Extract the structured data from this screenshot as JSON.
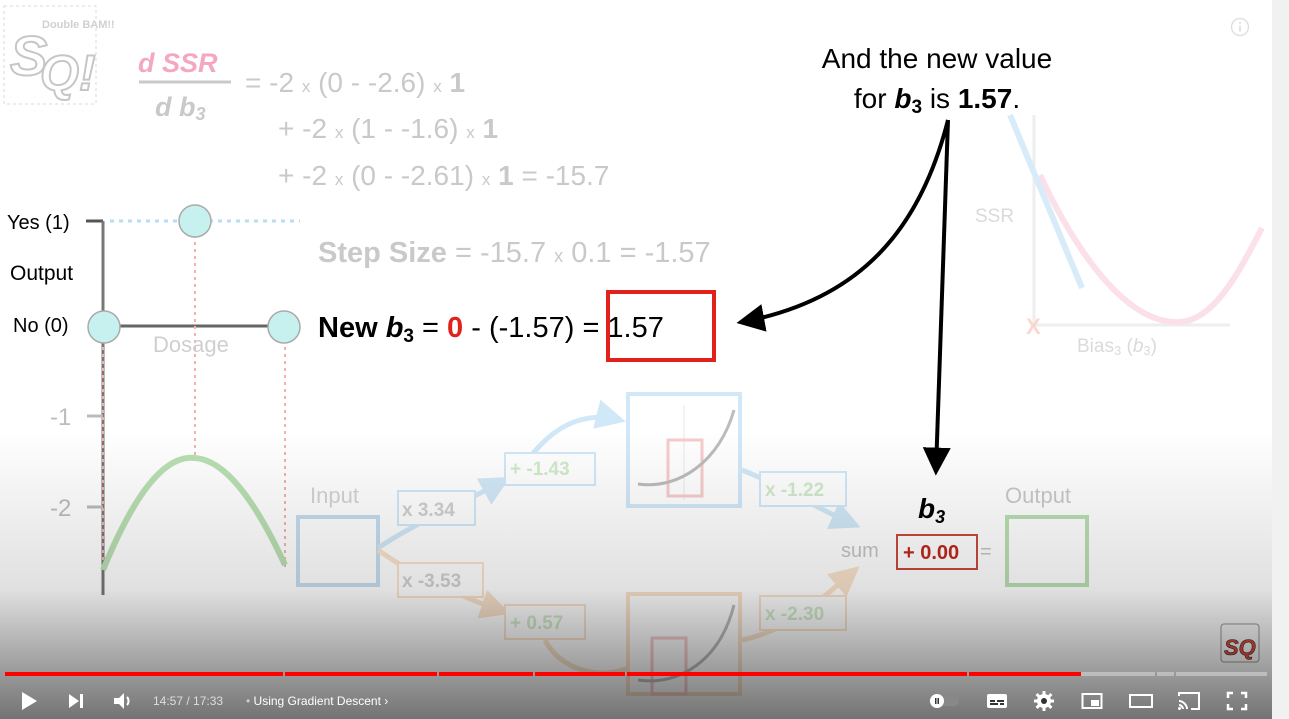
{
  "video": {
    "logo_text": "Double BAM!!",
    "derivative": {
      "numerator": "d SSR",
      "denominator_d": "d",
      "denominator_b": "b",
      "denominator_sub": "3",
      "line1_prefix": "= -2 ",
      "line1_mid": "(0 - -2.6)",
      "line1_one": "1",
      "line2_prefix": "+ -2 ",
      "line2_mid": "(1 - -1.6)",
      "line2_one": "1",
      "line3_prefix": "+ -2 ",
      "line3_mid": "(0 - -2.61)",
      "line3_one": "1",
      "line3_result": " = -15.7",
      "times": "x"
    },
    "step_size": {
      "label": "Step Size",
      "expr": " = -15.7 ",
      "expr2": " 0.1 = -1.57",
      "times": "x"
    },
    "new_b3": {
      "label_new": "New ",
      "label_b": "b",
      "sub": "3",
      "eq": " = ",
      "zero": "0",
      "minus": " - (-1.57) ",
      "boxed": "= 1.57"
    },
    "callout": {
      "line1": "And the new value",
      "line2_pre": "for ",
      "line2_b": "b",
      "line2_sub": "3",
      "line2_mid": " is ",
      "line2_val": "1.57",
      "line2_end": "."
    },
    "left_plot": {
      "yes_label": "Yes (1)",
      "output_label": "Output",
      "no_label": "No (0)",
      "dosage_label": "Dosage",
      "tick_neg1": "-1",
      "tick_neg2": "-2"
    },
    "ssr_plot": {
      "ylabel": "SSR",
      "xlabel_pre": "Bias",
      "xlabel_sub": "3",
      "xlabel_paren_b": "b",
      "xlabel_paren_sub": "3",
      "marker": "X"
    },
    "network": {
      "input_label": "Input",
      "w_top": "x 3.34",
      "w_bottom": "x -3.53",
      "b_top": "+ -1.43",
      "b_bottom": "+ 0.57",
      "w_out_top": "x -1.22",
      "w_out_bottom": "x -2.30",
      "b3_label": "b",
      "b3_sub": "3",
      "sum_label": "sum",
      "bias_value": "+ 0.00",
      "equals": "=",
      "output_label": "Output"
    },
    "colors": {
      "red": "#e3211c",
      "pink": "#f4a7c0",
      "blue": "#9dcbee",
      "orange": "#f3c79a",
      "green": "#a8d8a0",
      "teal": "#c6f1ee"
    }
  },
  "player": {
    "progress_played_fraction": 0.853,
    "time_current": "14:57",
    "time_separator": " / ",
    "time_total": "17:33",
    "chapter_bullet": "•",
    "chapter_title": "Using Gradient Descent",
    "icons": {
      "play": "play-icon",
      "next": "next-icon",
      "volume": "volume-icon",
      "autoplay": "autoplay-toggle-icon",
      "subtitles": "subtitles-icon",
      "settings": "gear-icon",
      "miniplayer": "miniplayer-icon",
      "theater": "theater-mode-icon",
      "cast": "cast-icon",
      "fullscreen": "fullscreen-icon",
      "info": "info-icon",
      "channel_badge": "channel-logo-icon"
    }
  }
}
